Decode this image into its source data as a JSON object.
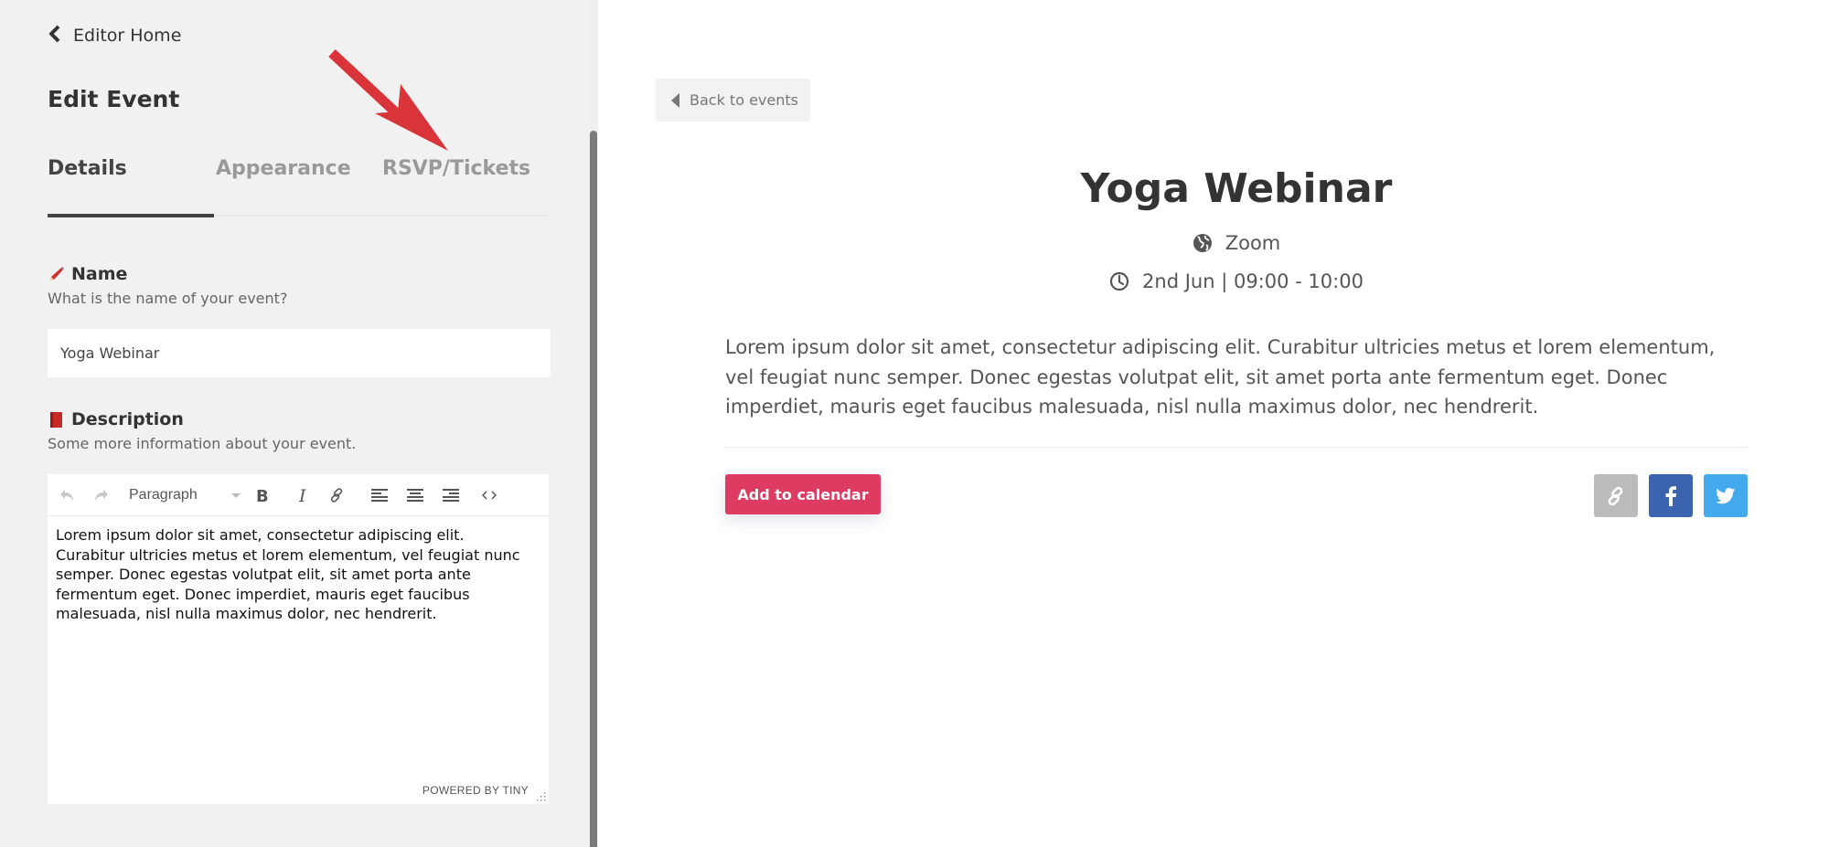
{
  "sidebar": {
    "back_label": "Editor Home",
    "title": "Edit Event",
    "tabs": [
      {
        "label": "Details",
        "active": true
      },
      {
        "label": "Appearance",
        "active": false
      },
      {
        "label": "RSVP/Tickets",
        "active": false
      }
    ],
    "name_field": {
      "label": "Name",
      "hint": "What is the name of your event?",
      "value": "Yoga Webinar",
      "icon": "pencil-icon"
    },
    "description_field": {
      "label": "Description",
      "hint": "Some more information about your event.",
      "icon": "book-icon",
      "toolbar": {
        "block_format": "Paragraph",
        "buttons": [
          "undo",
          "redo",
          "bold",
          "italic",
          "link",
          "align-left",
          "align-center",
          "align-right",
          "source-code"
        ]
      },
      "content": "Lorem ipsum dolor sit amet, consectetur adipiscing elit. Curabitur ultricies metus et lorem elementum, vel feugiat nunc semper. Donec egestas volutpat elit, sit amet porta ante fermentum eget. Donec imperdiet, mauris eget faucibus malesuada, nisl nulla maximus dolor, nec hendrerit.",
      "footer": "POWERED BY TINY"
    }
  },
  "annotation": {
    "type": "arrow",
    "color": "#d9343a",
    "points_to": "RSVP/Tickets"
  },
  "preview": {
    "back_label": "Back to events",
    "title": "Yoga Webinar",
    "location": "Zoom",
    "datetime": "2nd Jun | 09:00 - 10:00",
    "description": "Lorem ipsum dolor sit amet, consectetur adipiscing elit. Curabitur ultricies metus et lorem elementum, vel feugiat nunc semper. Donec egestas volutpat elit, sit amet porta ante fermentum eget. Donec imperdiet, mauris eget faucibus malesuada, nisl nulla maximus dolor, nec hendrerit.",
    "add_to_calendar_label": "Add to calendar",
    "share_buttons": [
      {
        "name": "copy-link",
        "color": "#bbbbbb"
      },
      {
        "name": "facebook",
        "color": "#3b63b0"
      },
      {
        "name": "twitter",
        "color": "#44aaee"
      }
    ],
    "accent_color": "#dd3b62"
  }
}
